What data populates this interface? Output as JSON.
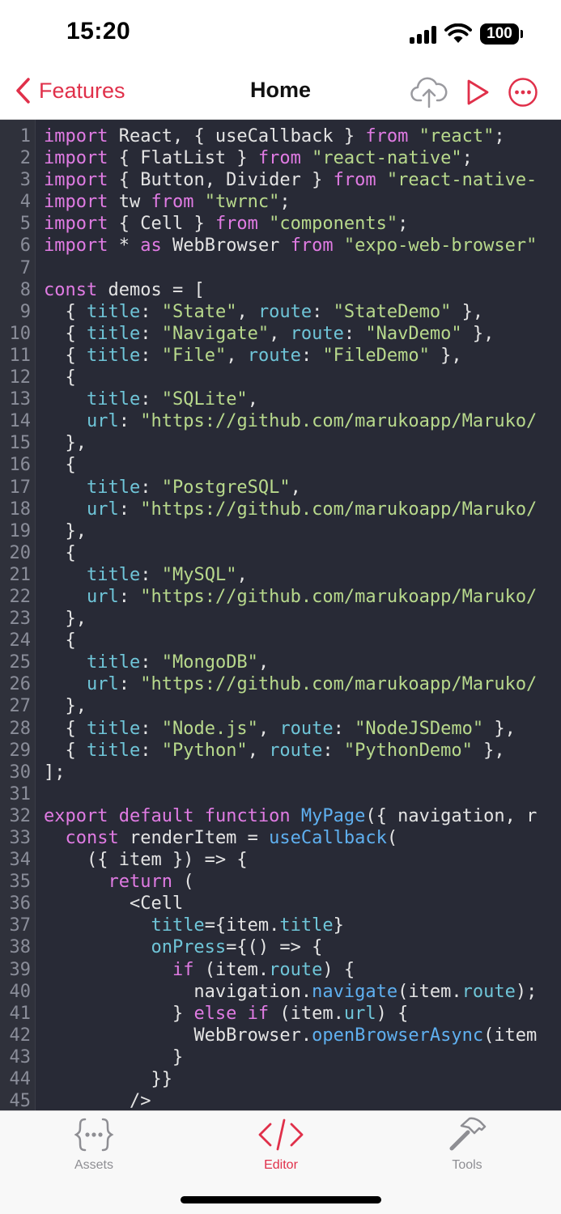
{
  "status_bar": {
    "time": "15:20",
    "battery": "100"
  },
  "nav": {
    "back_label": "Features",
    "title": "Home"
  },
  "code_lines": [
    [
      [
        "kw",
        "import"
      ],
      [
        "pl",
        " React, { useCallback } "
      ],
      [
        "kw",
        "from"
      ],
      [
        "pl",
        " "
      ],
      [
        "str",
        "\"react\""
      ],
      [
        "pl",
        ";"
      ]
    ],
    [
      [
        "kw",
        "import"
      ],
      [
        "pl",
        " { FlatList } "
      ],
      [
        "kw",
        "from"
      ],
      [
        "pl",
        " "
      ],
      [
        "str",
        "\"react-native\""
      ],
      [
        "pl",
        ";"
      ]
    ],
    [
      [
        "kw",
        "import"
      ],
      [
        "pl",
        " { Button, Divider } "
      ],
      [
        "kw",
        "from"
      ],
      [
        "pl",
        " "
      ],
      [
        "str",
        "\"react-native-"
      ]
    ],
    [
      [
        "kw",
        "import"
      ],
      [
        "pl",
        " tw "
      ],
      [
        "kw",
        "from"
      ],
      [
        "pl",
        " "
      ],
      [
        "str",
        "\"twrnc\""
      ],
      [
        "pl",
        ";"
      ]
    ],
    [
      [
        "kw",
        "import"
      ],
      [
        "pl",
        " { Cell } "
      ],
      [
        "kw",
        "from"
      ],
      [
        "pl",
        " "
      ],
      [
        "str",
        "\"components\""
      ],
      [
        "pl",
        ";"
      ]
    ],
    [
      [
        "kw",
        "import"
      ],
      [
        "pl",
        " * "
      ],
      [
        "kw",
        "as"
      ],
      [
        "pl",
        " WebBrowser "
      ],
      [
        "kw",
        "from"
      ],
      [
        "pl",
        " "
      ],
      [
        "str",
        "\"expo-web-browser\""
      ]
    ],
    [],
    [
      [
        "kw",
        "const"
      ],
      [
        "pl",
        " demos = ["
      ]
    ],
    [
      [
        "pl",
        "  { "
      ],
      [
        "prop",
        "title"
      ],
      [
        "pl",
        ": "
      ],
      [
        "str",
        "\"State\""
      ],
      [
        "pl",
        ", "
      ],
      [
        "prop",
        "route"
      ],
      [
        "pl",
        ": "
      ],
      [
        "str",
        "\"StateDemo\""
      ],
      [
        "pl",
        " },"
      ]
    ],
    [
      [
        "pl",
        "  { "
      ],
      [
        "prop",
        "title"
      ],
      [
        "pl",
        ": "
      ],
      [
        "str",
        "\"Navigate\""
      ],
      [
        "pl",
        ", "
      ],
      [
        "prop",
        "route"
      ],
      [
        "pl",
        ": "
      ],
      [
        "str",
        "\"NavDemo\""
      ],
      [
        "pl",
        " },"
      ]
    ],
    [
      [
        "pl",
        "  { "
      ],
      [
        "prop",
        "title"
      ],
      [
        "pl",
        ": "
      ],
      [
        "str",
        "\"File\""
      ],
      [
        "pl",
        ", "
      ],
      [
        "prop",
        "route"
      ],
      [
        "pl",
        ": "
      ],
      [
        "str",
        "\"FileDemo\""
      ],
      [
        "pl",
        " },"
      ]
    ],
    [
      [
        "pl",
        "  {"
      ]
    ],
    [
      [
        "pl",
        "    "
      ],
      [
        "prop",
        "title"
      ],
      [
        "pl",
        ": "
      ],
      [
        "str",
        "\"SQLite\""
      ],
      [
        "pl",
        ","
      ]
    ],
    [
      [
        "pl",
        "    "
      ],
      [
        "prop",
        "url"
      ],
      [
        "pl",
        ": "
      ],
      [
        "str",
        "\"https://github.com/marukoapp/Maruko/"
      ]
    ],
    [
      [
        "pl",
        "  },"
      ]
    ],
    [
      [
        "pl",
        "  {"
      ]
    ],
    [
      [
        "pl",
        "    "
      ],
      [
        "prop",
        "title"
      ],
      [
        "pl",
        ": "
      ],
      [
        "str",
        "\"PostgreSQL\""
      ],
      [
        "pl",
        ","
      ]
    ],
    [
      [
        "pl",
        "    "
      ],
      [
        "prop",
        "url"
      ],
      [
        "pl",
        ": "
      ],
      [
        "str",
        "\"https://github.com/marukoapp/Maruko/"
      ]
    ],
    [
      [
        "pl",
        "  },"
      ]
    ],
    [
      [
        "pl",
        "  {"
      ]
    ],
    [
      [
        "pl",
        "    "
      ],
      [
        "prop",
        "title"
      ],
      [
        "pl",
        ": "
      ],
      [
        "str",
        "\"MySQL\""
      ],
      [
        "pl",
        ","
      ]
    ],
    [
      [
        "pl",
        "    "
      ],
      [
        "prop",
        "url"
      ],
      [
        "pl",
        ": "
      ],
      [
        "str",
        "\"https://github.com/marukoapp/Maruko/"
      ]
    ],
    [
      [
        "pl",
        "  },"
      ]
    ],
    [
      [
        "pl",
        "  {"
      ]
    ],
    [
      [
        "pl",
        "    "
      ],
      [
        "prop",
        "title"
      ],
      [
        "pl",
        ": "
      ],
      [
        "str",
        "\"MongoDB\""
      ],
      [
        "pl",
        ","
      ]
    ],
    [
      [
        "pl",
        "    "
      ],
      [
        "prop",
        "url"
      ],
      [
        "pl",
        ": "
      ],
      [
        "str",
        "\"https://github.com/marukoapp/Maruko/"
      ]
    ],
    [
      [
        "pl",
        "  },"
      ]
    ],
    [
      [
        "pl",
        "  { "
      ],
      [
        "prop",
        "title"
      ],
      [
        "pl",
        ": "
      ],
      [
        "str",
        "\"Node.js\""
      ],
      [
        "pl",
        ", "
      ],
      [
        "prop",
        "route"
      ],
      [
        "pl",
        ": "
      ],
      [
        "str",
        "\"NodeJSDemo\""
      ],
      [
        "pl",
        " },"
      ]
    ],
    [
      [
        "pl",
        "  { "
      ],
      [
        "prop",
        "title"
      ],
      [
        "pl",
        ": "
      ],
      [
        "str",
        "\"Python\""
      ],
      [
        "pl",
        ", "
      ],
      [
        "prop",
        "route"
      ],
      [
        "pl",
        ": "
      ],
      [
        "str",
        "\"PythonDemo\""
      ],
      [
        "pl",
        " },"
      ]
    ],
    [
      [
        "pl",
        "];"
      ]
    ],
    [],
    [
      [
        "kw",
        "export"
      ],
      [
        "pl",
        " "
      ],
      [
        "kw",
        "default"
      ],
      [
        "pl",
        " "
      ],
      [
        "kw",
        "function"
      ],
      [
        "pl",
        " "
      ],
      [
        "fn",
        "MyPage"
      ],
      [
        "pl",
        "({ navigation, r"
      ]
    ],
    [
      [
        "pl",
        "  "
      ],
      [
        "kw",
        "const"
      ],
      [
        "pl",
        " renderItem = "
      ],
      [
        "fn",
        "useCallback"
      ],
      [
        "pl",
        "("
      ]
    ],
    [
      [
        "pl",
        "    ({ item }) => {"
      ]
    ],
    [
      [
        "pl",
        "      "
      ],
      [
        "kw",
        "return"
      ],
      [
        "pl",
        " ("
      ]
    ],
    [
      [
        "pl",
        "        <Cell"
      ]
    ],
    [
      [
        "pl",
        "          "
      ],
      [
        "prop",
        "title"
      ],
      [
        "pl",
        "={item."
      ],
      [
        "prop",
        "title"
      ],
      [
        "pl",
        "}"
      ]
    ],
    [
      [
        "pl",
        "          "
      ],
      [
        "prop",
        "onPress"
      ],
      [
        "pl",
        "={() => {"
      ]
    ],
    [
      [
        "pl",
        "            "
      ],
      [
        "kw",
        "if"
      ],
      [
        "pl",
        " (item."
      ],
      [
        "prop",
        "route"
      ],
      [
        "pl",
        ") {"
      ]
    ],
    [
      [
        "pl",
        "              navigation."
      ],
      [
        "fn",
        "navigate"
      ],
      [
        "pl",
        "(item."
      ],
      [
        "prop",
        "route"
      ],
      [
        "pl",
        ");"
      ]
    ],
    [
      [
        "pl",
        "            } "
      ],
      [
        "kw",
        "else"
      ],
      [
        "pl",
        " "
      ],
      [
        "kw",
        "if"
      ],
      [
        "pl",
        " (item."
      ],
      [
        "prop",
        "url"
      ],
      [
        "pl",
        ") {"
      ]
    ],
    [
      [
        "pl",
        "              WebBrowser."
      ],
      [
        "fn",
        "openBrowserAsync"
      ],
      [
        "pl",
        "(item"
      ]
    ],
    [
      [
        "pl",
        "            }"
      ]
    ],
    [
      [
        "pl",
        "          }}"
      ]
    ],
    [
      [
        "pl",
        "        />"
      ]
    ]
  ],
  "tabs": [
    {
      "label": "Assets",
      "icon": "braces-icon",
      "active": false
    },
    {
      "label": "Editor",
      "icon": "code-icon",
      "active": true
    },
    {
      "label": "Tools",
      "icon": "hammer-icon",
      "active": false
    }
  ],
  "colors": {
    "accent": "#e0304a",
    "editor_bg": "#282a36",
    "keyword": "#e07be3",
    "string": "#b8d98c",
    "property": "#6fc5d8",
    "function": "#5fb0f0"
  }
}
